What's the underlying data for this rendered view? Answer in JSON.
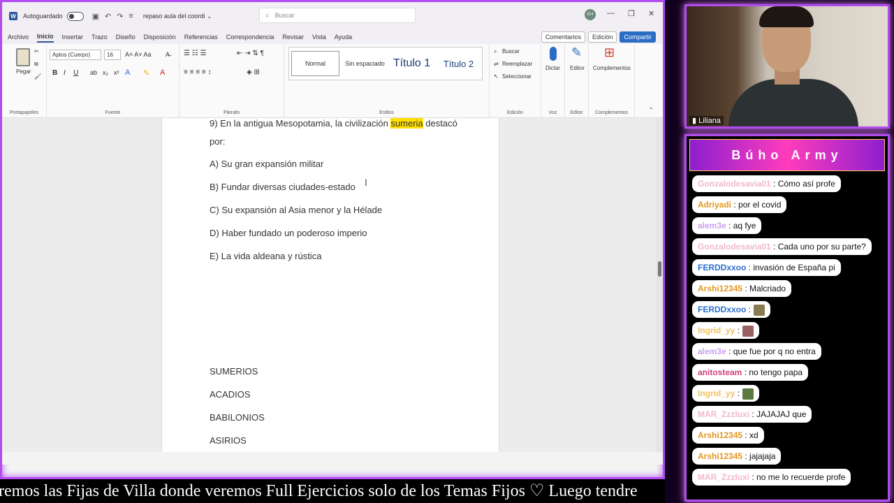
{
  "word": {
    "autosave_label": "Autoguardado",
    "doc_name": "repaso aula del coordi",
    "search_placeholder": "Buscar",
    "avatar_initials": "EH",
    "menu_tabs": [
      "Archivo",
      "Inicio",
      "Insertar",
      "Trazo",
      "Diseño",
      "Disposición",
      "Referencias",
      "Correspondencia",
      "Revisar",
      "Vista",
      "Ayuda"
    ],
    "comments_btn": "Comentarios",
    "edit_btn": "Edición",
    "share_btn": "Compartir",
    "ribbon": {
      "paste": "Pegar",
      "clipboard": "Portapapeles",
      "font_name": "Aptos (Cuerpo)",
      "font_size": "16",
      "font_group": "Fuente",
      "paragraph_group": "Párrafo",
      "styles_group": "Estilos",
      "style_normal": "Normal",
      "style_nospacing": "Sin espaciado",
      "style_t1": "Título 1",
      "style_t2": "Título 2",
      "find": "Buscar",
      "replace": "Reemplazar",
      "select": "Seleccionar",
      "editing_group": "Edición",
      "dictate": "Dictar",
      "voice_group": "Voz",
      "editor": "Editor",
      "editor_group": "Editor",
      "addins": "Complementos",
      "addins_group": "Complementos"
    },
    "question": {
      "line1_pre": "9) En la antigua Mesopotamia, la civilización ",
      "line1_hl": "sumeria",
      "line1_post": " destacó",
      "line2": "por:",
      "options": [
        "A) Su gran expansión militar",
        "B) Fundar diversas ciudades-estado",
        "C) Su expansión al Asia menor y la Hélade",
        "D) Haber fundado un poderoso imperio",
        "E) La vida aldeana y rústica"
      ]
    },
    "list": [
      "SUMERIOS",
      "ACADIOS",
      "BABILONIOS",
      "ASIRIOS"
    ]
  },
  "ticker": "remos las Fijas de Villa donde veremos Full Ejercicios solo de los Temas Fijos    ♡   Luego tendre",
  "cam_label": "Liliana",
  "chat": {
    "title": "Búho Army",
    "messages": [
      {
        "user": "Gonzalodesavia01",
        "color": "#f2b8c6",
        "text": ": Cómo así profe"
      },
      {
        "user": "Adriyadi",
        "color": "#e3961e",
        "text": ": por el covid"
      },
      {
        "user": "alem3e",
        "color": "#c9a0f0",
        "text": ": aq fye"
      },
      {
        "user": "Gonzalodesavia01",
        "color": "#f2b8c6",
        "text": ": Cada uno por su parte?"
      },
      {
        "user": "FERDDxxoo",
        "color": "#2a6ed0",
        "text": ": invasión de España pi"
      },
      {
        "user": "Arshi12345",
        "color": "#e3961e",
        "text": ": Malcriado"
      },
      {
        "user": "FERDDxxoo",
        "color": "#2a6ed0",
        "text": ":",
        "emote": "#8a7a50"
      },
      {
        "user": "Ingrid_yy",
        "color": "#f0c060",
        "text": ":",
        "emote": "#9a6060"
      },
      {
        "user": "alem3e",
        "color": "#c9a0f0",
        "text": ": que fue por q no entra"
      },
      {
        "user": "anitosteam",
        "color": "#d0407a",
        "text": ": no tengo papa"
      },
      {
        "user": "Ingrid_yy",
        "color": "#f0c060",
        "text": ":",
        "emote": "#5a7a40"
      },
      {
        "user": "MAR_Zzzluxi",
        "color": "#f2b8c6",
        "text": ": JAJAJAJ que"
      },
      {
        "user": "Arshi12345",
        "color": "#e3961e",
        "text": ": xd"
      },
      {
        "user": "Arshi12345",
        "color": "#e3961e",
        "text": ": jajajaja"
      },
      {
        "user": "MAR_Zzzluxi",
        "color": "#f2b8c6",
        "text": ": no me lo recuerde profe"
      }
    ]
  }
}
